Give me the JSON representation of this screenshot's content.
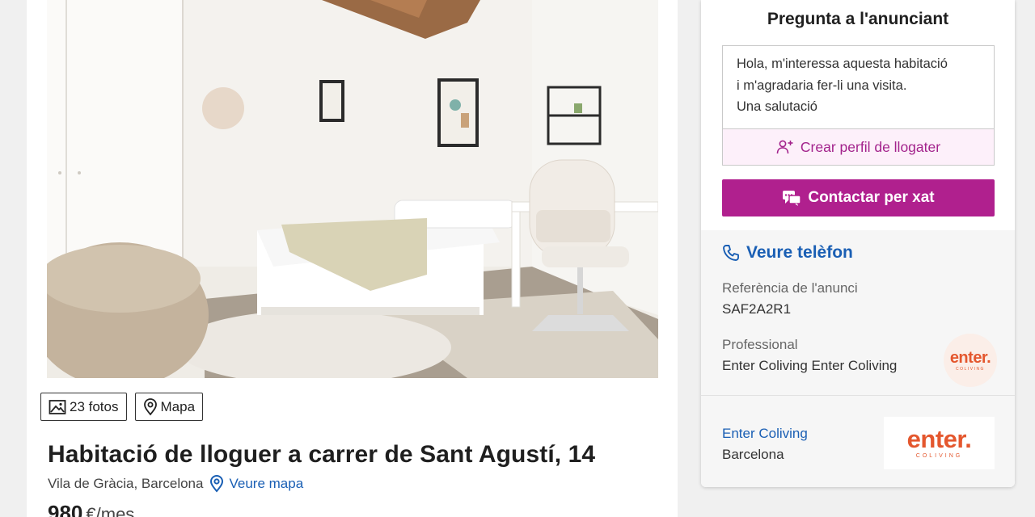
{
  "gallery": {
    "photos_count_label": "23 fotos",
    "map_label": "Mapa"
  },
  "listing": {
    "title": "Habitació de lloguer a carrer de Sant Agustí, 14",
    "location": "Vila de Gràcia, Barcelona",
    "see_map_label": "Veure mapa",
    "price": "980",
    "price_unit": "€/mes"
  },
  "contact": {
    "title": "Pregunta a l'anunciant",
    "message": "Hola, m'interessa aquesta habitació\ni m'agradaria fer-li una visita.\nUna salutació",
    "create_profile_label": "Crear perfil de llogater",
    "chat_label": "Contactar per xat",
    "phone_label": "Veure telèfon"
  },
  "advertiser": {
    "reference_label": "Referència de l'anunci",
    "reference_value": "SAF2A2R1",
    "type_label": "Professional",
    "name": "Enter Coliving Enter Coliving",
    "agency_name": "Enter Coliving",
    "agency_city": "Barcelona",
    "logo_wordmark": "enter.",
    "logo_subtext": "COLIVING"
  },
  "colors": {
    "brand_magenta": "#b0208e",
    "link_blue": "#1a5fb4",
    "logo_orange": "#e4572e"
  },
  "icons": [
    "image-icon",
    "map-pin-icon",
    "add-user-icon",
    "chat-icon",
    "phone-icon"
  ]
}
